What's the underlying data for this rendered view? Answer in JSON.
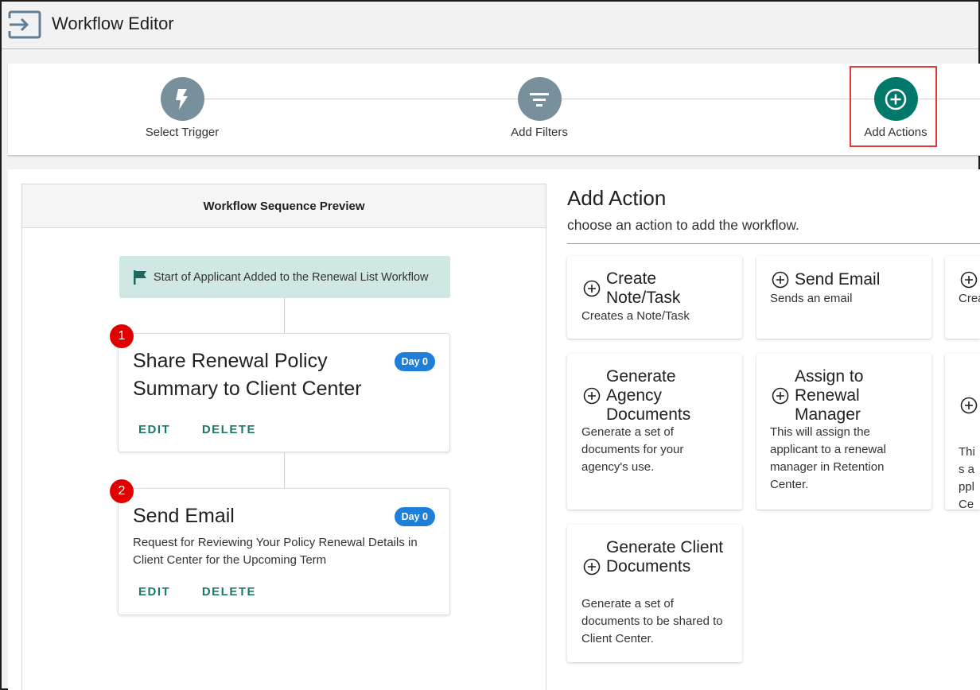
{
  "app": {
    "title": "Workflow Editor"
  },
  "stepper": {
    "steps": [
      {
        "label": "Select Trigger",
        "icon": "bolt-icon",
        "active": false
      },
      {
        "label": "Add Filters",
        "icon": "filter-icon",
        "active": false
      },
      {
        "label": "Add Actions",
        "icon": "plus-circle-icon",
        "active": true
      }
    ]
  },
  "preview": {
    "header": "Workflow Sequence Preview",
    "start_label": "Start of Applicant Added to the Renewal List Workflow",
    "items": [
      {
        "number": "1",
        "title": "Share Renewal Policy Summary to Client Center",
        "badge": "Day 0",
        "description": "",
        "edit": "EDIT",
        "delete": "DELETE"
      },
      {
        "number": "2",
        "title": "Send Email",
        "badge": "Day 0",
        "description": "Request for Reviewing Your Policy Renewal Details in Client Center for the Upcoming Term",
        "edit": "EDIT",
        "delete": "DELETE"
      }
    ]
  },
  "add_action": {
    "title": "Add Action",
    "subtitle": "choose an action to add the workflow.",
    "cards": [
      {
        "title": "Create Note/Task",
        "description": "Creates a Note/Task"
      },
      {
        "title": "Send Email",
        "description": "Sends an email"
      },
      {
        "title": "",
        "description": "Crea"
      },
      {
        "title": "Generate Agency Documents",
        "description": "Generate a set of documents for your agency's use."
      },
      {
        "title": "Assign to Renewal Manager",
        "description": "This will assign the applicant to a renewal manager in Retention Center."
      },
      {
        "title": "",
        "description": "This appl Cen"
      },
      {
        "title": "Generate Client Documents",
        "description": "Generate a set of documents to be shared to Client Center."
      }
    ]
  },
  "colors": {
    "accent": "#00796b",
    "step_inactive": "#78909c",
    "badge": "#1e7ed8",
    "number_badge": "#e00000",
    "link": "#1a7a6a",
    "highlight": "#e53935"
  }
}
